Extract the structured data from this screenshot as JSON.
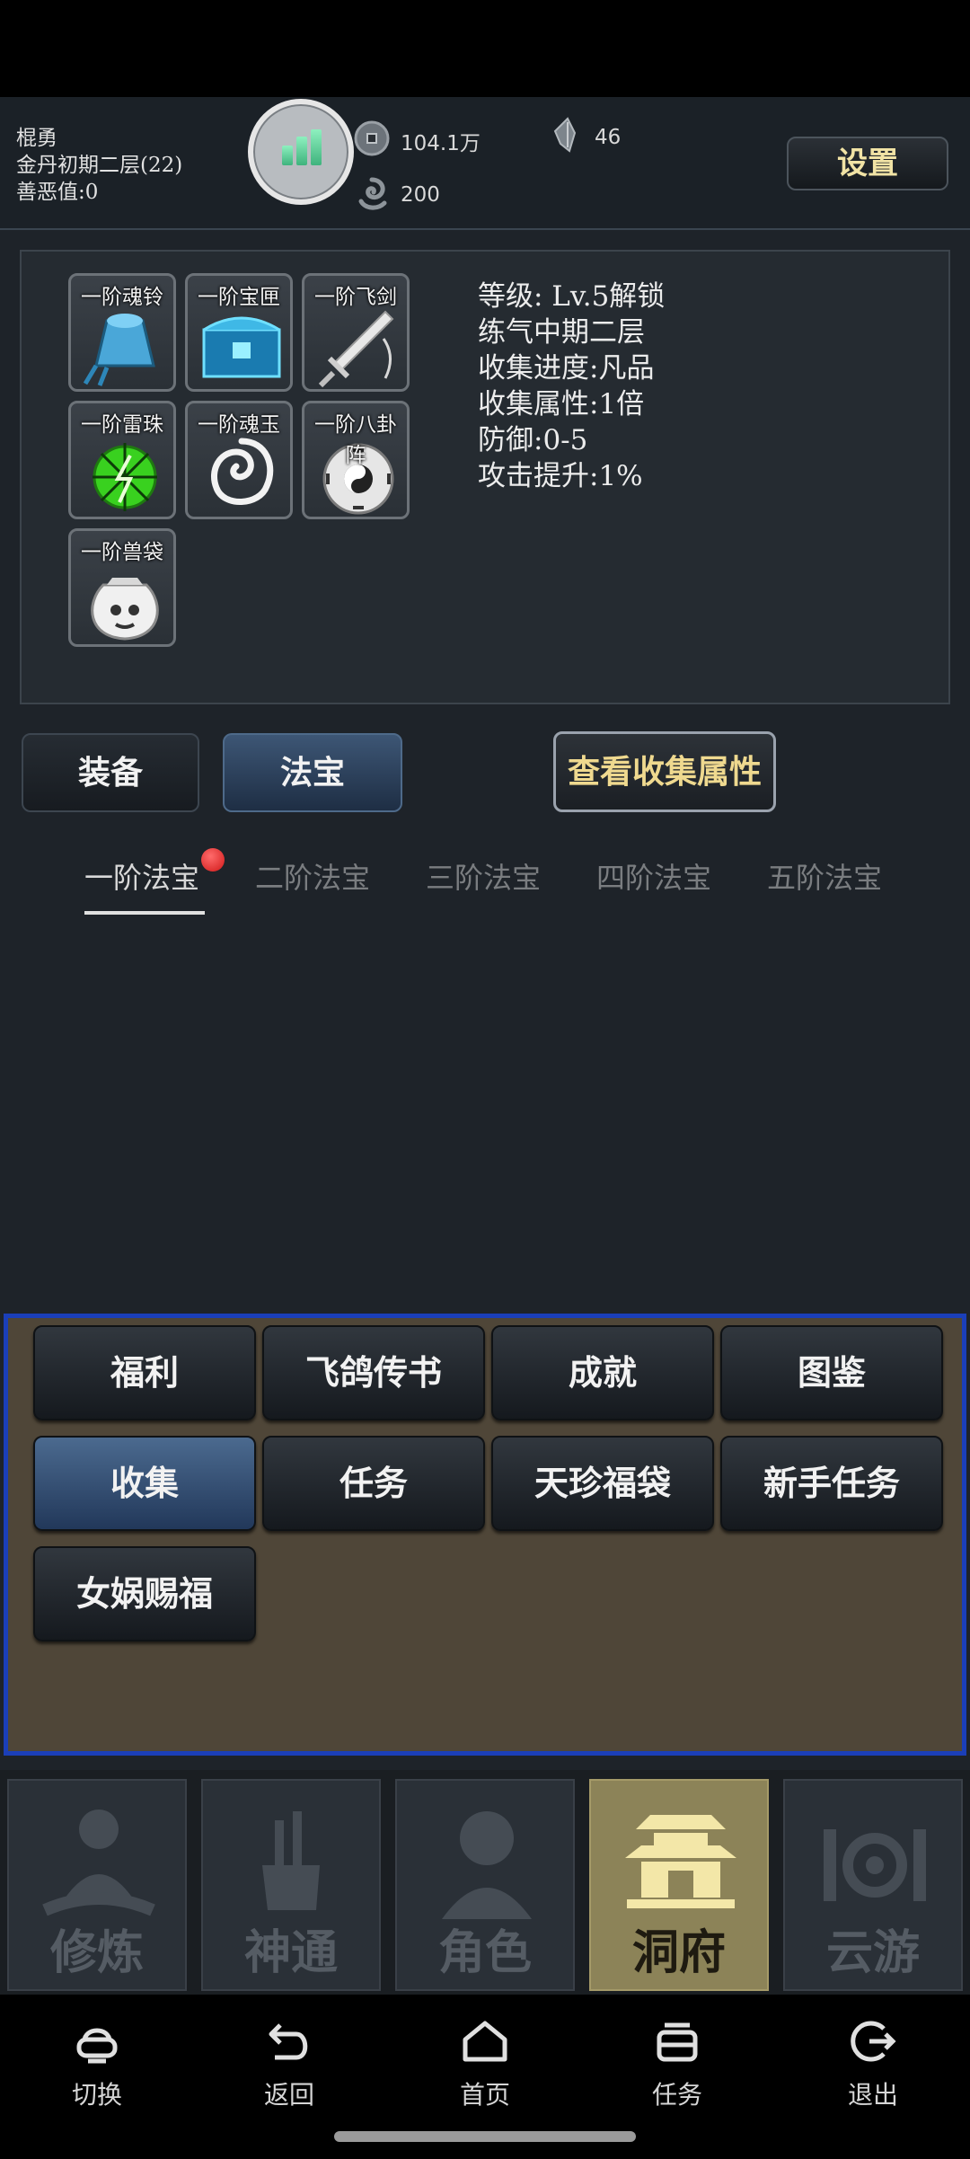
{
  "header": {
    "player_name": "棍勇",
    "realm": "金丹初期二层(22)",
    "karma": "善恶值:0",
    "coins": "104.1万",
    "spirit": "46",
    "essence": "200",
    "settings_label": "设置"
  },
  "artifacts": [
    {
      "label": "一阶魂铃",
      "icon": "bell-icon"
    },
    {
      "label": "一阶宝匣",
      "icon": "chest-icon"
    },
    {
      "label": "一阶飞剑",
      "icon": "sword-icon"
    },
    {
      "label": "一阶雷珠",
      "icon": "thunder-orb-icon"
    },
    {
      "label": "一阶魂玉",
      "icon": "soul-jade-icon"
    },
    {
      "label": "一阶八卦阵",
      "icon": "bagua-icon"
    },
    {
      "label": "一阶兽袋",
      "icon": "beast-bag-icon"
    }
  ],
  "info": {
    "level": "等级: Lv.5解锁",
    "realm": "练气中期二层",
    "progress": "收集进度:凡品",
    "attribute": "收集属性:1倍",
    "defense": "防御:0-5",
    "attack": "攻击提升:1%"
  },
  "tabs": {
    "equipment": "装备",
    "treasure": "法宝",
    "view_collection": "查看收集属性"
  },
  "tiers": [
    "一阶法宝",
    "二阶法宝",
    "三阶法宝",
    "四阶法宝",
    "五阶法宝"
  ],
  "menu": [
    "福利",
    "飞鸽传书",
    "成就",
    "图鉴",
    "收集",
    "任务",
    "天珍福袋",
    "新手任务",
    "女娲赐福"
  ],
  "game_nav": [
    "修炼",
    "神通",
    "角色",
    "洞府",
    "云游"
  ],
  "system_nav": [
    "切换",
    "返回",
    "首页",
    "任务",
    "退出"
  ],
  "colors": {
    "accent_gold": "#efd98f",
    "menu_border": "#1b3fb8",
    "active_tab": "#3d5675",
    "active_nav": "#8c8358"
  }
}
